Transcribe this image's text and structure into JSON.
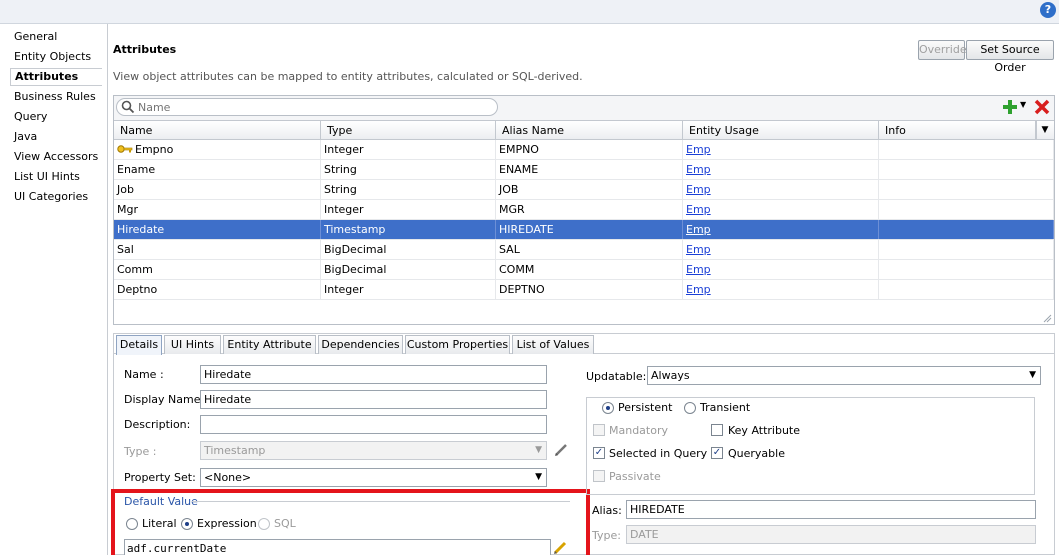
{
  "help": {
    "label": "?"
  },
  "nav": {
    "items": [
      {
        "label": "General"
      },
      {
        "label": "Entity Objects"
      },
      {
        "label": "Attributes"
      },
      {
        "label": "Business Rules"
      },
      {
        "label": "Query"
      },
      {
        "label": "Java"
      },
      {
        "label": "View Accessors"
      },
      {
        "label": "List UI Hints"
      },
      {
        "label": "UI Categories"
      }
    ],
    "selected": "Attributes"
  },
  "header": {
    "title": "Attributes",
    "subtitle": "View object attributes can be mapped to entity attributes, calculated or SQL-derived.",
    "override_label": "Override",
    "set_source_order_label": "Set Source Order"
  },
  "search": {
    "placeholder": "Name"
  },
  "table": {
    "columns": [
      "Name",
      "Type",
      "Alias Name",
      "Entity Usage",
      "Info"
    ],
    "rows": [
      {
        "name": "Empno",
        "type": "Integer",
        "alias": "EMPNO",
        "usage": "Emp",
        "key": true
      },
      {
        "name": "Ename",
        "type": "String",
        "alias": "ENAME",
        "usage": "Emp"
      },
      {
        "name": "Job",
        "type": "String",
        "alias": "JOB",
        "usage": "Emp"
      },
      {
        "name": "Mgr",
        "type": "Integer",
        "alias": "MGR",
        "usage": "Emp"
      },
      {
        "name": "Hiredate",
        "type": "Timestamp",
        "alias": "HIREDATE",
        "usage": "Emp",
        "selected": true
      },
      {
        "name": "Sal",
        "type": "BigDecimal",
        "alias": "SAL",
        "usage": "Emp"
      },
      {
        "name": "Comm",
        "type": "BigDecimal",
        "alias": "COMM",
        "usage": "Emp"
      },
      {
        "name": "Deptno",
        "type": "Integer",
        "alias": "DEPTNO",
        "usage": "Emp"
      }
    ]
  },
  "tabs": [
    "Details",
    "UI Hints",
    "Entity Attribute",
    "Dependencies",
    "Custom Properties",
    "List of Values"
  ],
  "details": {
    "name_label": "Name :",
    "name_value": "Hiredate",
    "display_name_label": "Display Name:",
    "display_name_value": "Hiredate",
    "description_label": "Description:",
    "description_value": "",
    "type_label": "Type :",
    "type_value": "Timestamp",
    "property_set_label": "Property Set:",
    "property_set_value": "<None>",
    "updatable_label": "Updatable:",
    "updatable_value": "Always",
    "persistent_label": "Persistent",
    "transient_label": "Transient",
    "mandatory_label": "Mandatory",
    "key_attribute_label": "Key Attribute",
    "selected_in_query_label": "Selected in Query",
    "queryable_label": "Queryable",
    "passivate_label": "Passivate",
    "alias_label": "Alias:",
    "alias_value": "HIREDATE",
    "type2_label": "Type:",
    "type2_value": "DATE",
    "default_value_label": "Default Value",
    "literal_label": "Literal",
    "expression_label": "Expression",
    "sql_label": "SQL",
    "expression_value": "adf.currentDate"
  },
  "colors": {
    "selection": "#3e6fc9",
    "highlight_box": "#e4141b",
    "link": "#1a3fd6"
  }
}
